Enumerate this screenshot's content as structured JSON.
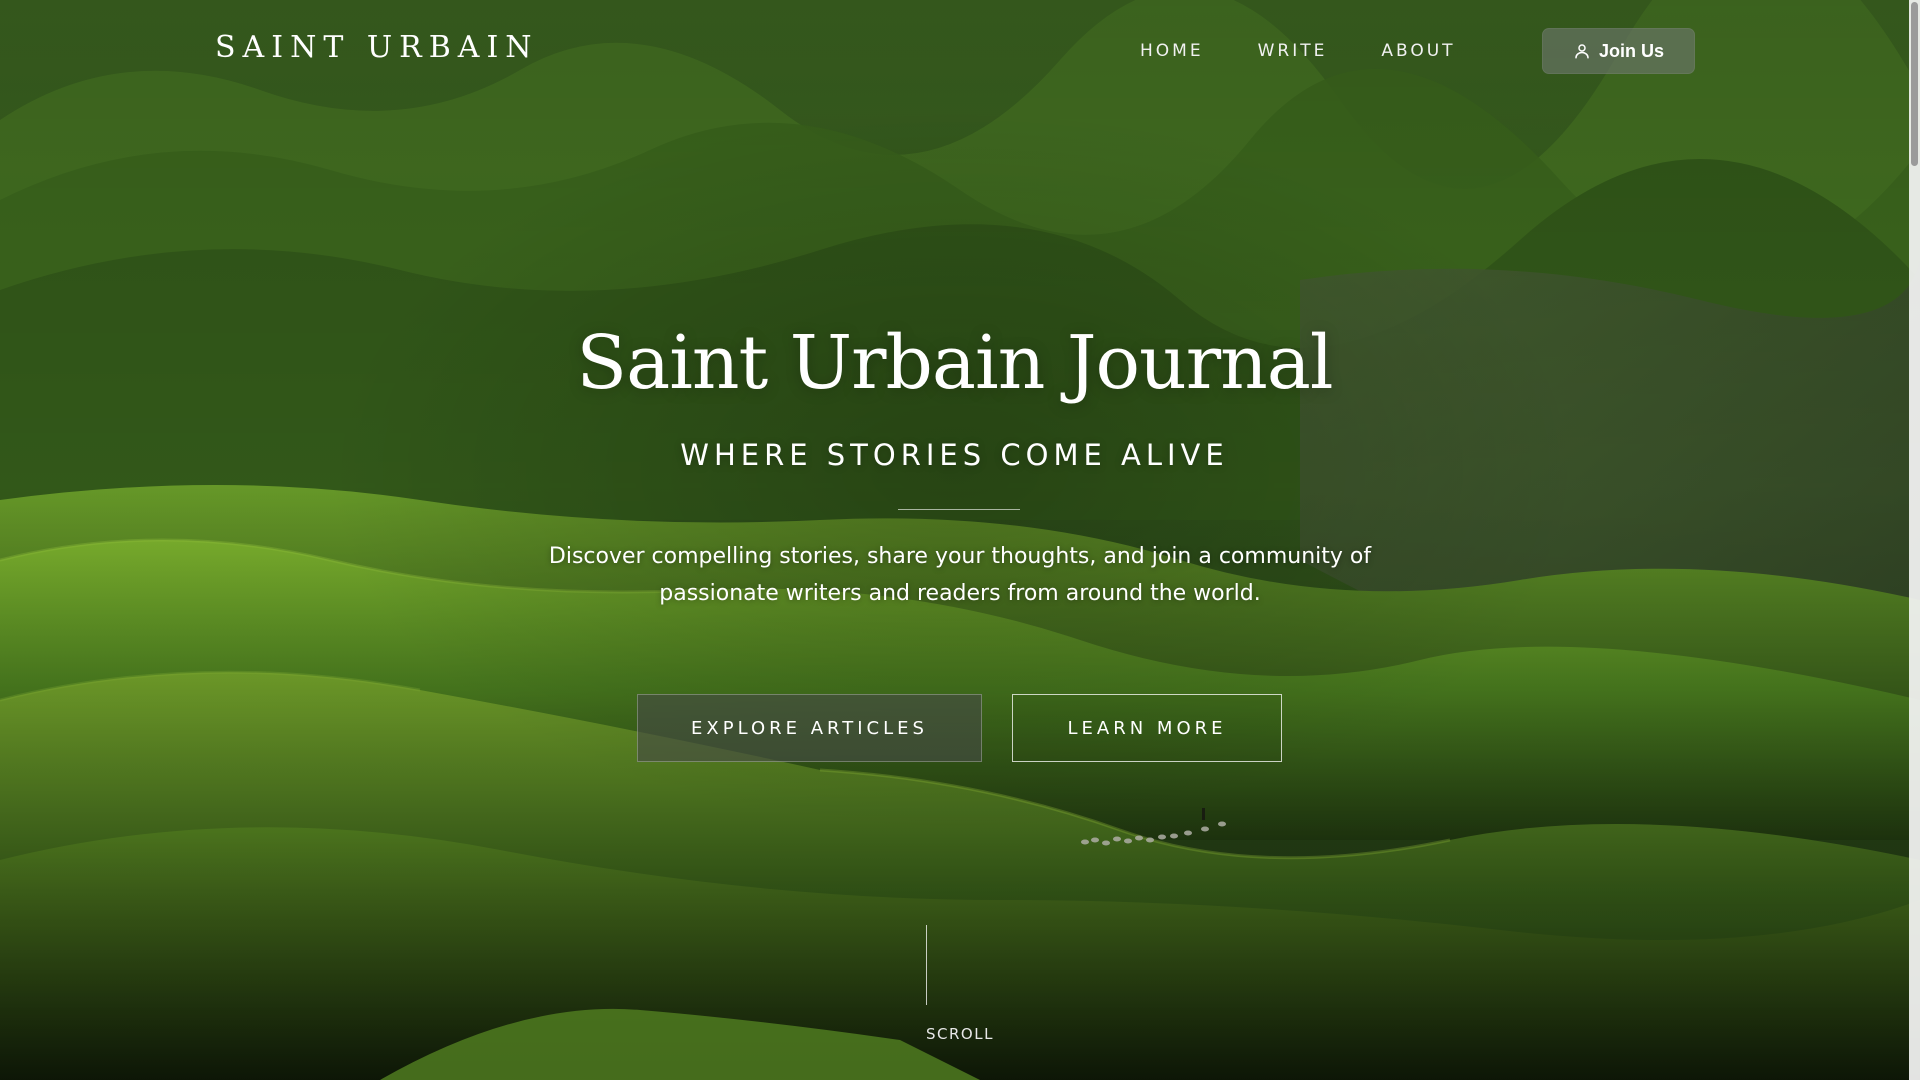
{
  "header": {
    "brand": "SAINT URBAIN",
    "nav": [
      {
        "label": "HOME"
      },
      {
        "label": "WRITE"
      },
      {
        "label": "ABOUT"
      }
    ],
    "join_label": "Join Us",
    "join_icon": "user-icon"
  },
  "hero": {
    "title": "Saint Urbain Journal",
    "subtitle": "WHERE STORIES COME ALIVE",
    "description": "Discover compelling stories, share your thoughts, and join a community of passionate writers and readers from around the world.",
    "primary_button": "EXPLORE ARTICLES",
    "secondary_button": "LEARN MORE",
    "scroll_label": "SCROLL"
  },
  "theme": {
    "hill_dark": "#1d2a12",
    "hill_mid": "#3e6a1c",
    "hill_light": "#79b02c"
  }
}
